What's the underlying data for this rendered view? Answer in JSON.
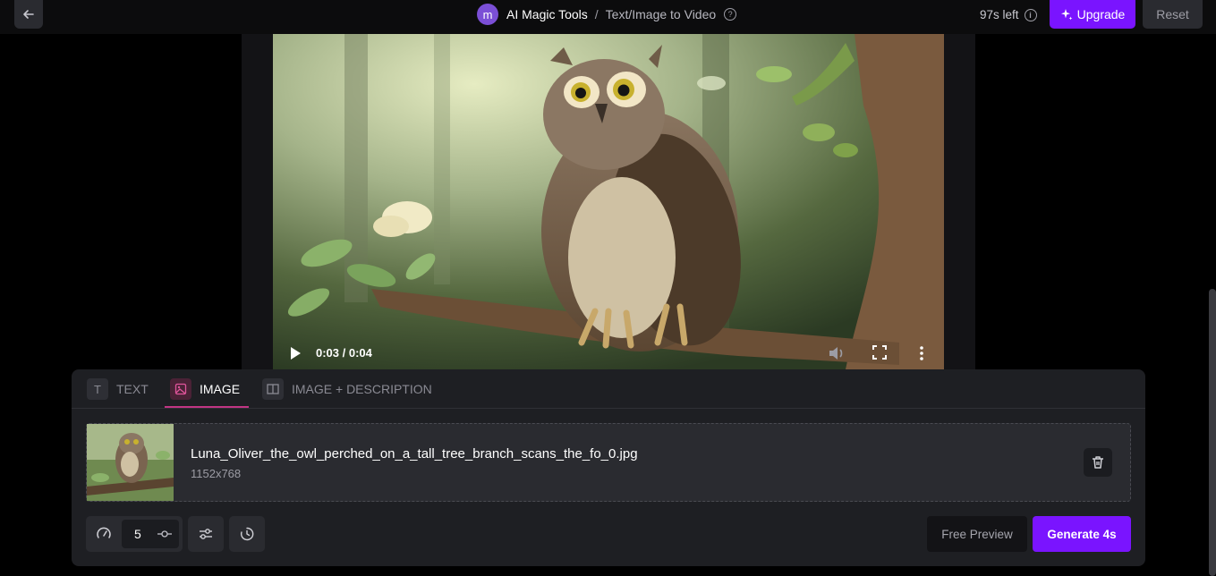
{
  "header": {
    "avatar_letter": "m",
    "app_name": "AI Magic Tools",
    "separator": "/",
    "page_title": "Text/Image to Video",
    "help_symbol": "?",
    "time_left": "97s left",
    "info_symbol": "i",
    "upgrade_label": "Upgrade",
    "reset_label": "Reset"
  },
  "video": {
    "time": "0:03 / 0:04",
    "progress": 0.75
  },
  "tabs": [
    {
      "label": "TEXT",
      "icon": "text-icon",
      "active": false
    },
    {
      "label": "IMAGE",
      "icon": "image-icon",
      "active": true
    },
    {
      "label": "IMAGE + DESCRIPTION",
      "icon": "split-layout-icon",
      "active": false
    }
  ],
  "file": {
    "name": "Luna_Oliver_the_owl_perched_on_a_tall_tree_branch_scans_the_fo_0.jpg",
    "dimensions": "1152x768"
  },
  "controls": {
    "steps_value": "5",
    "free_preview_label": "Free Preview",
    "generate_label": "Generate 4s"
  },
  "colors": {
    "accent": "#7a14ff",
    "tab_active_underline": "#c13584"
  }
}
